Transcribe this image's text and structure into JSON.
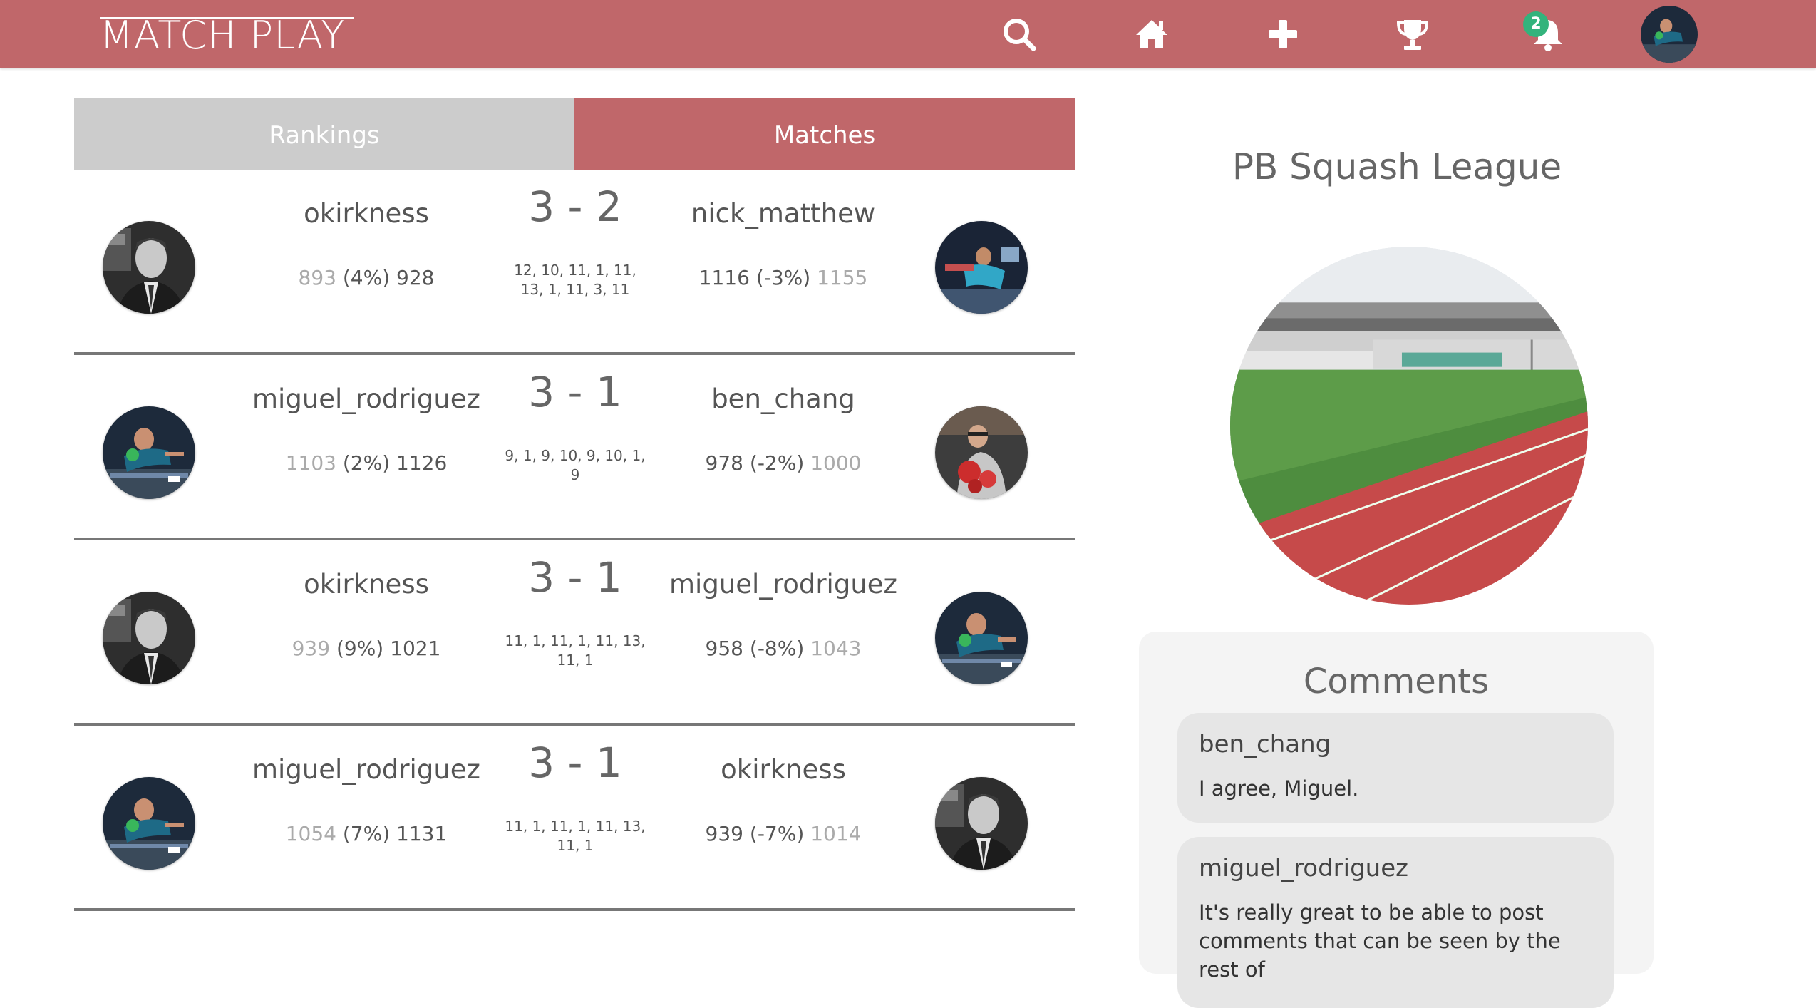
{
  "app": {
    "logo_text": "MATCH PLAY",
    "brand_color": "#c0676a",
    "nav_icons": [
      "search-icon",
      "home-icon",
      "plus-icon",
      "trophy-icon",
      "bell-icon"
    ],
    "notification_count": "2"
  },
  "tabs": [
    {
      "label": "Rankings",
      "active": false
    },
    {
      "label": "Matches",
      "active": true
    }
  ],
  "matches": [
    {
      "p1": {
        "name": "okirkness",
        "rating_before": "893",
        "change": "(4%)",
        "rating_after": "928"
      },
      "score": "3 - 2",
      "games_line1": "12, 10, 11, 1, 11,",
      "games_line2": "13, 1, 11, 3, 11",
      "p2": {
        "name": "nick_matthew",
        "rating_after": "1116",
        "change": "(-3%)",
        "rating_before": "1155"
      }
    },
    {
      "p1": {
        "name": "miguel_rodriguez",
        "rating_before": "1103",
        "change": "(2%)",
        "rating_after": "1126"
      },
      "score": "3 - 1",
      "games_line1": "9, 1, 9, 10, 9, 10, 1,",
      "games_line2": "9",
      "p2": {
        "name": "ben_chang",
        "rating_after": "978",
        "change": "(-2%)",
        "rating_before": "1000"
      }
    },
    {
      "p1": {
        "name": "okirkness",
        "rating_before": "939",
        "change": "(9%)",
        "rating_after": "1021"
      },
      "score": "3 - 1",
      "games_line1": "11, 1, 11, 1, 11, 13,",
      "games_line2": "11, 1",
      "p2": {
        "name": "miguel_rodriguez",
        "rating_after": "958",
        "change": "(-8%)",
        "rating_before": "1043"
      }
    },
    {
      "p1": {
        "name": "miguel_rodriguez",
        "rating_before": "1054",
        "change": "(7%)",
        "rating_after": "1131"
      },
      "score": "3 - 1",
      "games_line1": "11, 1, 11, 1, 11, 13,",
      "games_line2": "11, 1",
      "p2": {
        "name": "okirkness",
        "rating_after": "939",
        "change": "(-7%)",
        "rating_before": "1014"
      }
    }
  ],
  "league": {
    "title": "PB Squash League"
  },
  "comments": {
    "title": "Comments",
    "items": [
      {
        "author": "ben_chang",
        "text": "I agree, Miguel."
      },
      {
        "author": "miguel_rodriguez",
        "text": "It's really great to be able to post comments that can be seen by the rest of"
      }
    ]
  }
}
